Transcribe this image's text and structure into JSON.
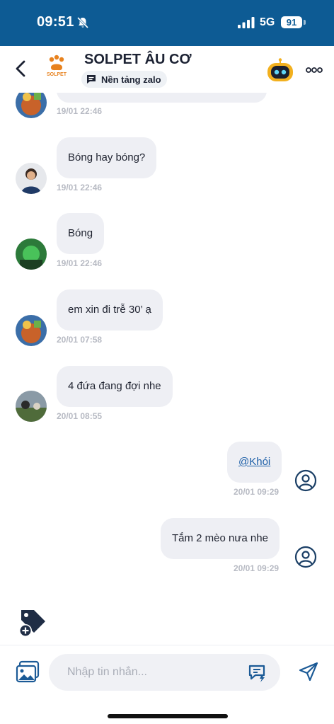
{
  "status_bar": {
    "time": "09:51",
    "network": "5G",
    "battery": "91"
  },
  "header": {
    "title": "SOLPET ÂU CƠ",
    "logo_text": "SOLPET",
    "platform_label": "Nền tảng zalo"
  },
  "messages": [
    {
      "id": "m0",
      "text": "",
      "time": "19/01 22:46",
      "side": "left"
    },
    {
      "id": "m1",
      "text": "Bóng hay bóng?",
      "time": "19/01 22:46",
      "side": "left"
    },
    {
      "id": "m2",
      "text": "Bóng",
      "time": "19/01 22:46",
      "side": "left"
    },
    {
      "id": "m3",
      "text": "em xin đi trễ 30’ ạ",
      "time": "20/01 07:58",
      "side": "left"
    },
    {
      "id": "m4",
      "text": "4 đứa đang đợi nhe",
      "time": "20/01 08:55",
      "side": "left"
    },
    {
      "id": "m5",
      "text": "@Khói",
      "time": "20/01 09:29",
      "side": "right"
    },
    {
      "id": "m6",
      "text": "Tắm 2 mèo nưa nhe",
      "time": "20/01 09:29",
      "side": "right"
    }
  ],
  "composer": {
    "placeholder": "Nhập tin nhắn..."
  },
  "colors": {
    "header_bar": "#0d5b94",
    "bubble": "#eeeff4",
    "accent": "#1d5fa8"
  }
}
